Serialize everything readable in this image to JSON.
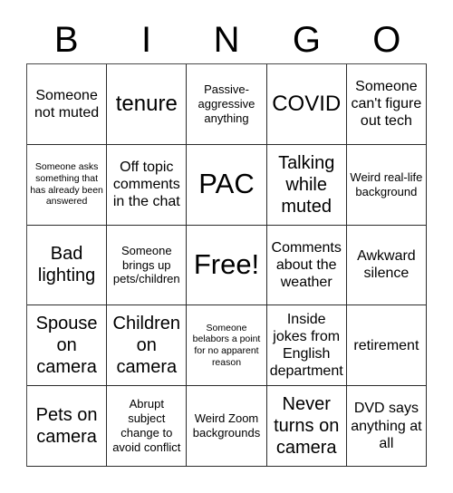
{
  "card": {
    "title_letters": [
      "B",
      "I",
      "N",
      "G",
      "O"
    ],
    "columns": 5,
    "rows": 5,
    "colors": {
      "background": "#ffffff",
      "text": "#000000",
      "grid_line": "#2b2b2b"
    },
    "free_space": {
      "row": 3,
      "column": 3,
      "label": "Free!"
    },
    "cells": [
      {
        "text": "Someone not muted",
        "size": "md"
      },
      {
        "text": "tenure",
        "size": "xl"
      },
      {
        "text": "Passive-aggressive anything",
        "size": "sm"
      },
      {
        "text": "COVID",
        "size": "xl"
      },
      {
        "text": "Someone can't figure out tech",
        "size": "md"
      },
      {
        "text": "Someone asks something that has already been answered",
        "size": "xs"
      },
      {
        "text": "Off topic comments in the chat",
        "size": "md"
      },
      {
        "text": "PAC",
        "size": "xxl"
      },
      {
        "text": "Talking while muted",
        "size": "lg"
      },
      {
        "text": "Weird real-life background",
        "size": "sm"
      },
      {
        "text": "Bad lighting",
        "size": "lg"
      },
      {
        "text": "Someone brings up pets/children",
        "size": "sm"
      },
      {
        "text": "Free!",
        "size": "xxl"
      },
      {
        "text": "Comments about the weather",
        "size": "md"
      },
      {
        "text": "Awkward silence",
        "size": "md"
      },
      {
        "text": "Spouse on camera",
        "size": "lg"
      },
      {
        "text": "Children on camera",
        "size": "lg"
      },
      {
        "text": "Someone belabors a point for no apparent reason",
        "size": "xs"
      },
      {
        "text": "Inside jokes from English department",
        "size": "md"
      },
      {
        "text": "retirement",
        "size": "md"
      },
      {
        "text": "Pets on camera",
        "size": "lg"
      },
      {
        "text": "Abrupt subject change to avoid conflict",
        "size": "sm"
      },
      {
        "text": "Weird Zoom backgrounds",
        "size": "sm"
      },
      {
        "text": "Never turns on camera",
        "size": "lg"
      },
      {
        "text": "DVD says anything at all",
        "size": "md"
      }
    ]
  }
}
